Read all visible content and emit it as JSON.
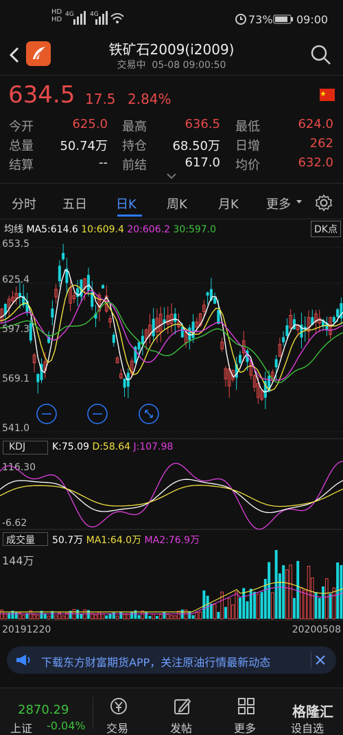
{
  "status_bar": {
    "sig1": "HD 4G",
    "sig2": "HD 4G",
    "battery": "73%",
    "time": "09:00"
  },
  "header": {
    "title": "铁矿石2009(i2009)",
    "subtitle": "交易中  05-08 09:00:50"
  },
  "quote": {
    "price": "634.5",
    "change": "17.5",
    "pct": "2.84%",
    "rows": [
      [
        [
          "今开",
          "625.0",
          "red"
        ],
        [
          "最高",
          "636.5",
          "red"
        ],
        [
          "最低",
          "624.0",
          "red"
        ]
      ],
      [
        [
          "总量",
          "50.74万",
          "white"
        ],
        [
          "持仓",
          "68.50万",
          "white"
        ],
        [
          "日增",
          "262",
          "red"
        ]
      ],
      [
        [
          "结算",
          "--",
          "white"
        ],
        [
          "前结",
          "617.0",
          "white"
        ],
        [
          "均价",
          "632.0",
          "red"
        ]
      ]
    ]
  },
  "tabs": [
    "分时",
    "五日",
    "日K",
    "周K",
    "月K",
    "更多"
  ],
  "main_chart": {
    "ma_label": "均线",
    "ma5": "MA5:614.6",
    "ma10": "10:609.4",
    "ma20": "20:606.2",
    "ma30": "30:597.0",
    "dk": "DK点",
    "y_labels": [
      "653.5",
      "625.4",
      "597.3",
      "569.1",
      "541.0"
    ]
  },
  "kdj": {
    "name": "KDJ",
    "k": "K:75.09",
    "d": "D:58.64",
    "j": "J:107.98",
    "y_top": "116.30",
    "y_bottom": "-6.62"
  },
  "volume": {
    "name": "成交量",
    "val": "50.7万",
    "ma1": "MA1:64.0万",
    "ma2": "MA2:76.9万",
    "y_top": "144万",
    "date_start": "20191220",
    "date_end": "20200508"
  },
  "banner": {
    "text": "下载东方财富期货APP，关注原油行情最新动态"
  },
  "bottom_nav": {
    "index_value": "2870.29",
    "index_name": "上证",
    "index_change": "-0.04%",
    "items": [
      "交易",
      "发帖",
      "更多",
      "设自选"
    ],
    "watermark": "格隆汇"
  },
  "colors": {
    "up": "#e84a4a",
    "down": "#19d3da",
    "ma5": "#ffffff",
    "ma10": "#f0e040",
    "ma20": "#e040e0",
    "ma30": "#3ec13e",
    "accent": "#2b7bff"
  }
}
